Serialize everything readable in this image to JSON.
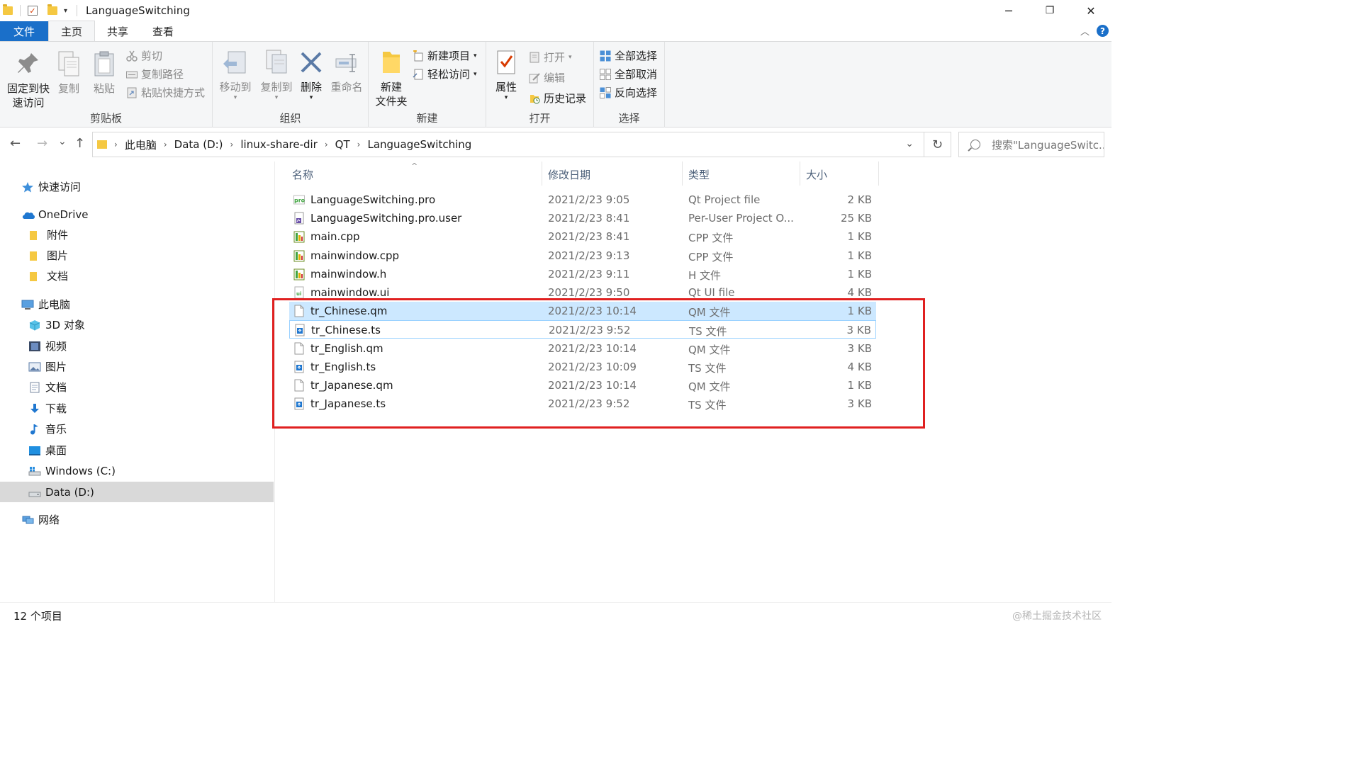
{
  "window": {
    "title": "LanguageSwitching",
    "minimize": "─",
    "restore": "❐",
    "close": "✕"
  },
  "quick_access": {
    "check_glyph": "✓",
    "dropdown": "▾"
  },
  "tabs": [
    {
      "label": "文件"
    },
    {
      "label": "主页"
    },
    {
      "label": "共享"
    },
    {
      "label": "查看"
    }
  ],
  "ribbon": {
    "clipboard": {
      "label": "剪贴板",
      "pin": "固定到快\n速访问",
      "pin_l1": "固定到快",
      "pin_l2": "速访问",
      "copy": "复制",
      "paste": "粘贴",
      "cut": "剪切",
      "copy_path": "复制路径",
      "paste_shortcut": "粘贴快捷方式"
    },
    "organize": {
      "label": "组织",
      "move_to": "移动到",
      "copy_to": "复制到",
      "delete": "删除",
      "rename": "重命名"
    },
    "new": {
      "label": "新建",
      "new_folder_l1": "新建",
      "new_folder_l2": "文件夹",
      "new_item": "新建项目",
      "easy_access": "轻松访问"
    },
    "open": {
      "label": "打开",
      "properties": "属性",
      "open": "打开",
      "edit": "编辑",
      "history": "历史记录"
    },
    "select": {
      "label": "选择",
      "select_all": "全部选择",
      "select_none": "全部取消",
      "invert": "反向选择"
    }
  },
  "address": {
    "crumbs": [
      "此电脑",
      "Data (D:)",
      "linux-share-dir",
      "QT",
      "LanguageSwitching"
    ],
    "search_placeholder": "搜索\"LanguageSwitc..."
  },
  "nav": {
    "back": "←",
    "forward": "→",
    "recent": "⌄",
    "up": "↑",
    "refresh": "↻",
    "address_dropdown": "⌄",
    "expand": "›",
    "items": [
      {
        "label": "快速访问"
      },
      {
        "label": "OneDrive"
      },
      {
        "label": "附件"
      },
      {
        "label": "图片"
      },
      {
        "label": "文档"
      },
      {
        "label": "此电脑"
      },
      {
        "label": "3D 对象"
      },
      {
        "label": "视频"
      },
      {
        "label": "图片"
      },
      {
        "label": "文档"
      },
      {
        "label": "下载"
      },
      {
        "label": "音乐"
      },
      {
        "label": "桌面"
      },
      {
        "label": "Windows (C:)"
      },
      {
        "label": "Data (D:)"
      },
      {
        "label": "网络"
      }
    ]
  },
  "columns": {
    "name": "名称",
    "date": "修改日期",
    "type": "类型",
    "size": "大小",
    "sort_caret": "^"
  },
  "files": [
    {
      "name": "LanguageSwitching.pro",
      "date": "2021/2/23 9:05",
      "type": "Qt Project file",
      "size": "2 KB",
      "icon": "pro-icon"
    },
    {
      "name": "LanguageSwitching.pro.user",
      "date": "2021/2/23 8:41",
      "type": "Per-User Project O...",
      "size": "25 KB",
      "icon": "user-file-icon"
    },
    {
      "name": "main.cpp",
      "date": "2021/2/23 8:41",
      "type": "CPP 文件",
      "size": "1 KB",
      "icon": "cpp-icon"
    },
    {
      "name": "mainwindow.cpp",
      "date": "2021/2/23 9:13",
      "type": "CPP 文件",
      "size": "1 KB",
      "icon": "cpp-icon"
    },
    {
      "name": "mainwindow.h",
      "date": "2021/2/23 9:11",
      "type": "H 文件",
      "size": "1 KB",
      "icon": "h-icon"
    },
    {
      "name": "mainwindow.ui",
      "date": "2021/2/23 9:50",
      "type": "Qt UI file",
      "size": "4 KB",
      "icon": "ui-icon"
    },
    {
      "name": "tr_Chinese.qm",
      "date": "2021/2/23 10:14",
      "type": "QM 文件",
      "size": "1 KB",
      "icon": "blank-file-icon"
    },
    {
      "name": "tr_Chinese.ts",
      "date": "2021/2/23 9:52",
      "type": "TS 文件",
      "size": "3 KB",
      "icon": "ts-icon"
    },
    {
      "name": "tr_English.qm",
      "date": "2021/2/23 10:14",
      "type": "QM 文件",
      "size": "3 KB",
      "icon": "blank-file-icon"
    },
    {
      "name": "tr_English.ts",
      "date": "2021/2/23 10:09",
      "type": "TS 文件",
      "size": "4 KB",
      "icon": "ts-icon"
    },
    {
      "name": "tr_Japanese.qm",
      "date": "2021/2/23 10:14",
      "type": "QM 文件",
      "size": "1 KB",
      "icon": "blank-file-icon"
    },
    {
      "name": "tr_Japanese.ts",
      "date": "2021/2/23 9:52",
      "type": "TS 文件",
      "size": "3 KB",
      "icon": "ts-icon"
    }
  ],
  "status": {
    "item_count": "12 个项目",
    "watermark": "@稀土掘金技术社区"
  },
  "colors": {
    "accent": "#1a6fc9",
    "selection": "#cce8ff",
    "highlight_box": "#e02020",
    "folder": "#f5c842"
  }
}
